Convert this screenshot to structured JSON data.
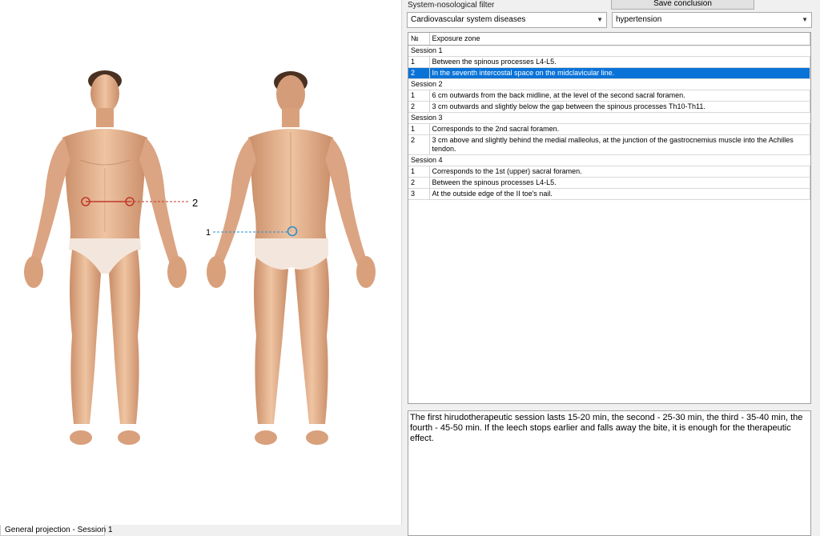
{
  "filter": {
    "label": "System-nosological filter",
    "system_value": "Cardiovascular system diseases",
    "disease_value": "hypertension"
  },
  "save_button": "Save conclusion",
  "table": {
    "headers": [
      "№",
      "Exposure zone"
    ],
    "sessions": [
      {
        "label": "Session 1",
        "rows": [
          {
            "num": "1",
            "zone": "Between the spinous processes L4-L5."
          },
          {
            "num": "2",
            "zone": "In the seventh intercostal space on the midclavicular line.",
            "selected": true
          }
        ]
      },
      {
        "label": "Session 2",
        "rows": [
          {
            "num": "1",
            "zone": "6 cm outwards from the back midline, at the level of the second sacral foramen."
          },
          {
            "num": "2",
            "zone": "3 cm outwards and slightly below the gap between the spinous processes Th10-Th11."
          }
        ]
      },
      {
        "label": "Session 3",
        "rows": [
          {
            "num": "1",
            "zone": "Corresponds to the 2nd sacral foramen."
          },
          {
            "num": "2",
            "zone": "3 cm above and slightly behind the medial malleolus, at the junction of the gastrocnemius muscle into the Achilles tendon."
          }
        ]
      },
      {
        "label": "Session 4",
        "rows": [
          {
            "num": "1",
            "zone": "Corresponds to the 1st (upper) sacral foramen."
          },
          {
            "num": "2",
            "zone": "Between the spinous processes L4-L5."
          },
          {
            "num": "3",
            "zone": "At the outside edge of the II toe's nail."
          }
        ]
      }
    ]
  },
  "description": "The first hirudotherapeutic session lasts 15-20 min, the second - 25-30 min, the third - 35-40 min, the fourth - 45-50 min. If the leech stops earlier and falls away the bite, it is enough for the therapeutic effect.",
  "tab_label": "General projection - Session 1",
  "body_markers": {
    "front_label": "2",
    "back_label": "1"
  },
  "colors": {
    "selection": "#0a73d8",
    "front_marker": "#c0392b",
    "back_marker": "#2a8fd0",
    "skin": "#e8b48f"
  }
}
